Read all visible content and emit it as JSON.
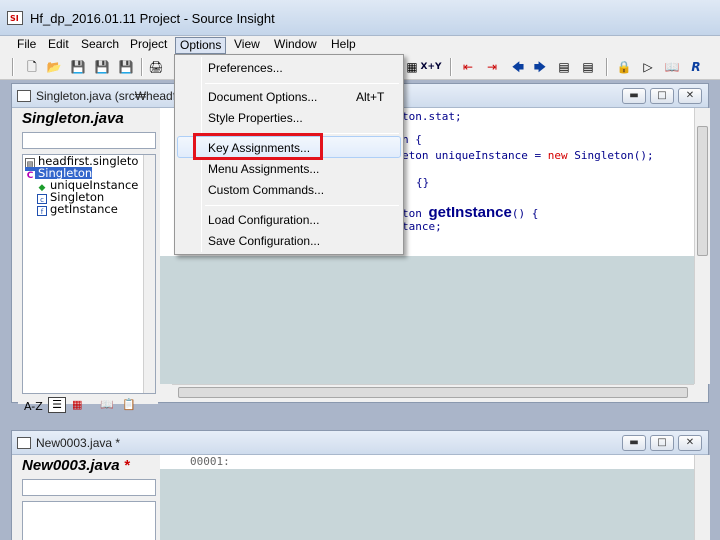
{
  "window": {
    "title": "Hf_dp_2016.01.11 Project - Source Insight"
  },
  "menubar": [
    "File",
    "Edit",
    "Search",
    "Project",
    "Options",
    "View",
    "Window",
    "Help"
  ],
  "options_menu": {
    "items": [
      {
        "label": "Preferences...",
        "shortcut": ""
      },
      {
        "label": "Document Options...",
        "shortcut": "Alt+T"
      },
      {
        "label": "Style Properties...",
        "shortcut": ""
      },
      {
        "label": "Key Assignments...",
        "shortcut": ""
      },
      {
        "label": "Menu Assignments...",
        "shortcut": ""
      },
      {
        "label": "Custom Commands...",
        "shortcut": ""
      },
      {
        "label": "Load Configuration...",
        "shortcut": ""
      },
      {
        "label": "Save Configuration...",
        "shortcut": ""
      }
    ],
    "highlighted": "Key Assignments..."
  },
  "doc1": {
    "title": "Singleton.java (src₩headf",
    "symbol_header": "Singleton.java",
    "tree": [
      "headfirst.singleto",
      "Singleton",
      "uniqueInstance",
      "Singleton",
      "getInstance"
    ],
    "code": {
      "line1": "ton.stat;",
      "line2": "n {",
      "line3a": "eton uniqueInstance = ",
      "line3kw": "new",
      "line3b": " Singleton();",
      "line4": "{}",
      "line5a": "ton ",
      "line5fn": "getInstance",
      "line5b": "() {",
      "line6": "tance;"
    },
    "sort_label": "A-Z"
  },
  "doc2": {
    "title": "New0003.java *",
    "symbol_header": "New0003.java",
    "modified_marker": "*",
    "line_number": "00001:"
  },
  "icons": {
    "toolbar_right": [
      "X+Y"
    ]
  },
  "colors": {
    "highlight_box": "#e3121c",
    "selected_tree": "#3366cc"
  }
}
